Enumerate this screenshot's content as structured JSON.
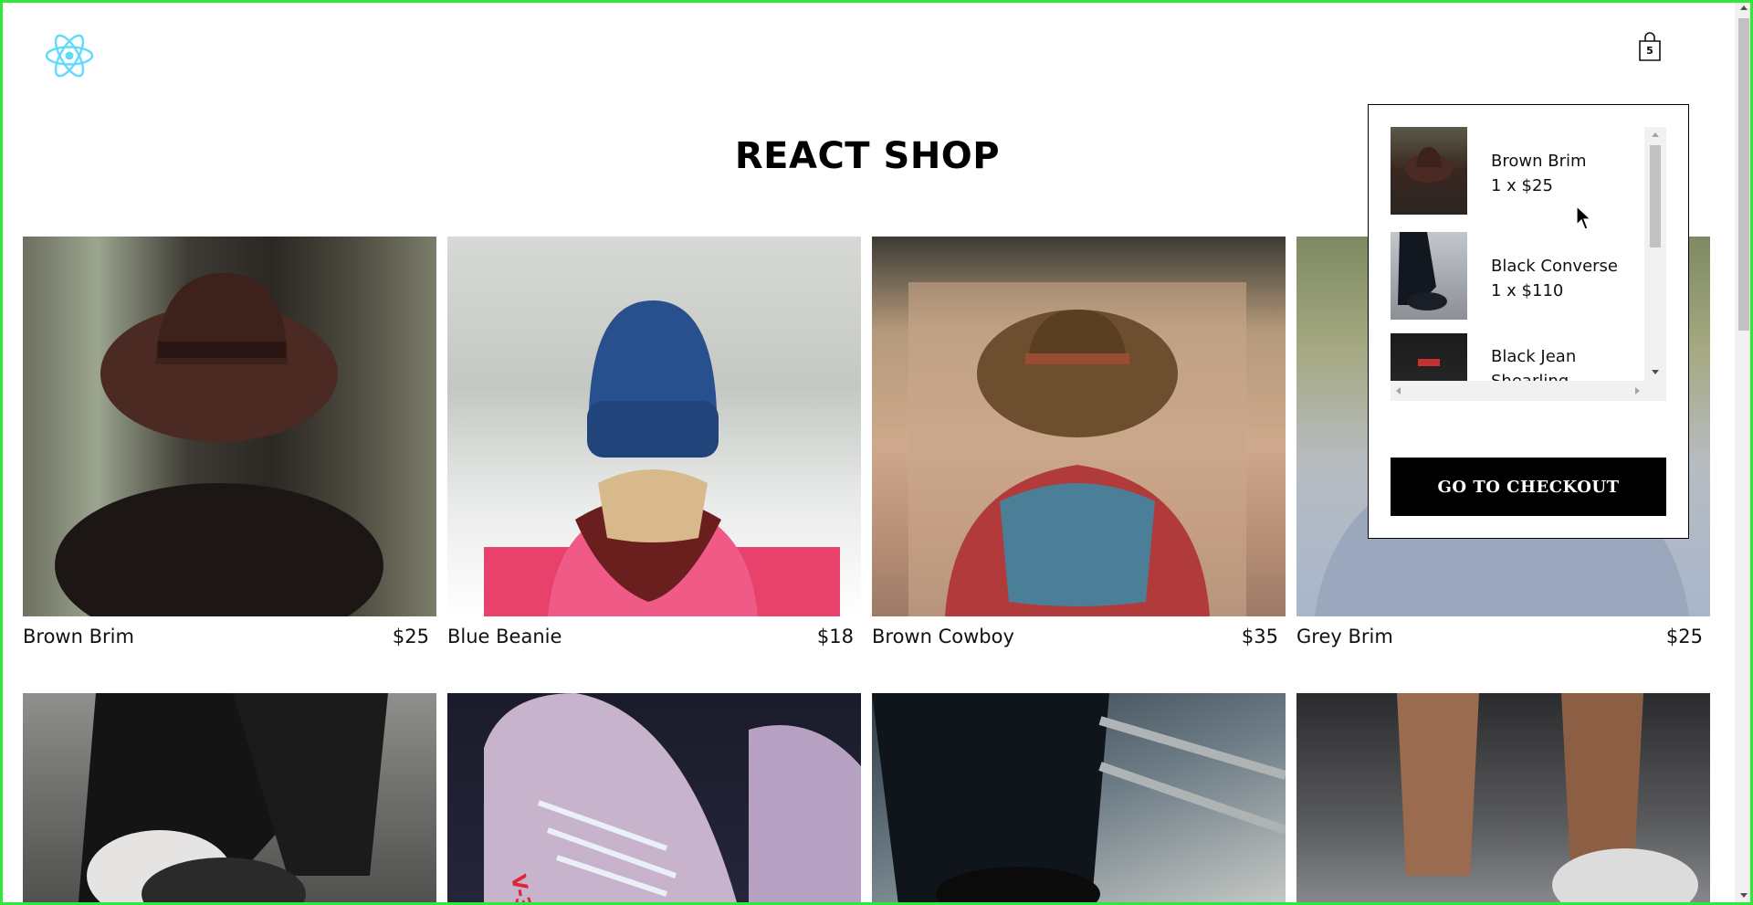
{
  "header": {
    "logo_icon": "react-atom-icon",
    "cart_icon": "shopping-bag-icon",
    "cart_count": "5"
  },
  "page_title": "REACT SHOP",
  "products": [
    {
      "name": "Brown Brim",
      "price": "$25"
    },
    {
      "name": "Blue Beanie",
      "price": "$18"
    },
    {
      "name": "Brown Cowboy",
      "price": "$35"
    },
    {
      "name": "Grey Brim",
      "price": "$25"
    },
    {
      "name": "",
      "price": ""
    },
    {
      "name": "",
      "price": ""
    },
    {
      "name": "",
      "price": ""
    },
    {
      "name": "",
      "price": ""
    }
  ],
  "cart_dropdown": {
    "items": [
      {
        "name": "Brown Brim",
        "qty_price": "1 x $25"
      },
      {
        "name": "Black Converse",
        "qty_price": "1 x $110"
      },
      {
        "name": "Black Jean Shearling",
        "qty_price": ""
      }
    ],
    "checkout_label": "GO TO CHECKOUT"
  },
  "colors": {
    "accent": "#61dafb",
    "button_bg": "#000000",
    "frame": "#2ee83a"
  }
}
